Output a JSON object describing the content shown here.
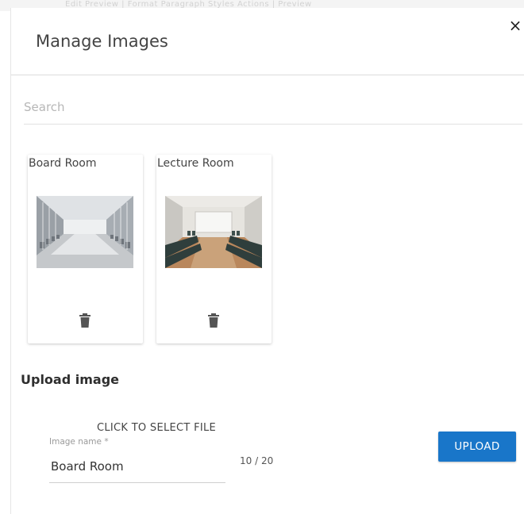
{
  "background": {
    "toolbar_text": "Edit   Preview   |   Format   Paragraph   Styles   Actions   |   Preview"
  },
  "dialog": {
    "title": "Manage Images",
    "close_label": "×"
  },
  "search": {
    "placeholder": "Search",
    "value": ""
  },
  "images": [
    {
      "name": "Board Room",
      "thumbnail": "board-room-photo",
      "delete_icon": "trash-icon"
    },
    {
      "name": "Lecture Room",
      "thumbnail": "lecture-room-photo",
      "delete_icon": "trash-icon"
    }
  ],
  "upload": {
    "heading": "Upload image",
    "select_file_label": "CLICK TO SELECT FILE",
    "name_field": {
      "label": "Image name *",
      "value": "Board Room",
      "counter": "10 / 20"
    },
    "button_label": "UPLOAD"
  },
  "colors": {
    "primary_button": "#1976c9",
    "divider": "#dcdcdc",
    "icon": "#555555"
  }
}
